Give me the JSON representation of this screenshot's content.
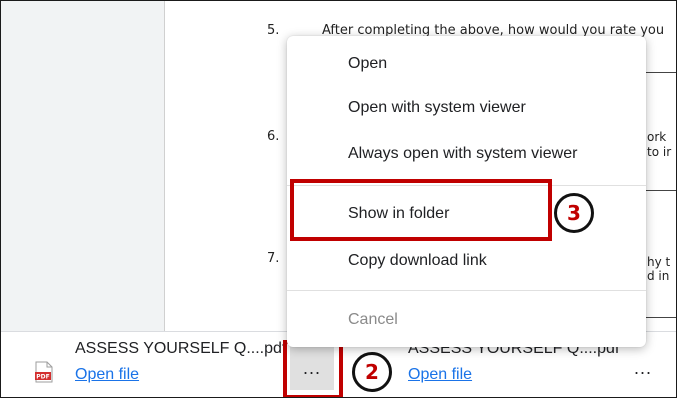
{
  "document": {
    "questions": [
      {
        "num": "5.",
        "text": "After completing the above, how would you rate you"
      },
      {
        "num": "6.",
        "fragments": [
          "ork",
          "to ir"
        ]
      },
      {
        "num": "7.",
        "fragments": [
          "hy t",
          "d in"
        ]
      }
    ]
  },
  "context_menu": {
    "items": [
      {
        "label": "Open",
        "enabled": true
      },
      {
        "label": "Open with system viewer",
        "enabled": true
      },
      {
        "label": "Always open with system viewer",
        "enabled": true
      },
      {
        "label": "Show in folder",
        "enabled": true
      },
      {
        "label": "Copy download link",
        "enabled": true
      },
      {
        "label": "Cancel",
        "enabled": false
      }
    ]
  },
  "downloads": [
    {
      "filename": "ASSESS YOURSELF Q....pdf",
      "action": "Open file",
      "icon": "pdf-file-icon",
      "more": "..."
    },
    {
      "filename": "ASSESS YOURSELF Q....pdf",
      "action": "Open file",
      "more": "..."
    }
  ],
  "annotations": {
    "step2": "2",
    "step3": "3",
    "highlight_color": "#c00000"
  }
}
